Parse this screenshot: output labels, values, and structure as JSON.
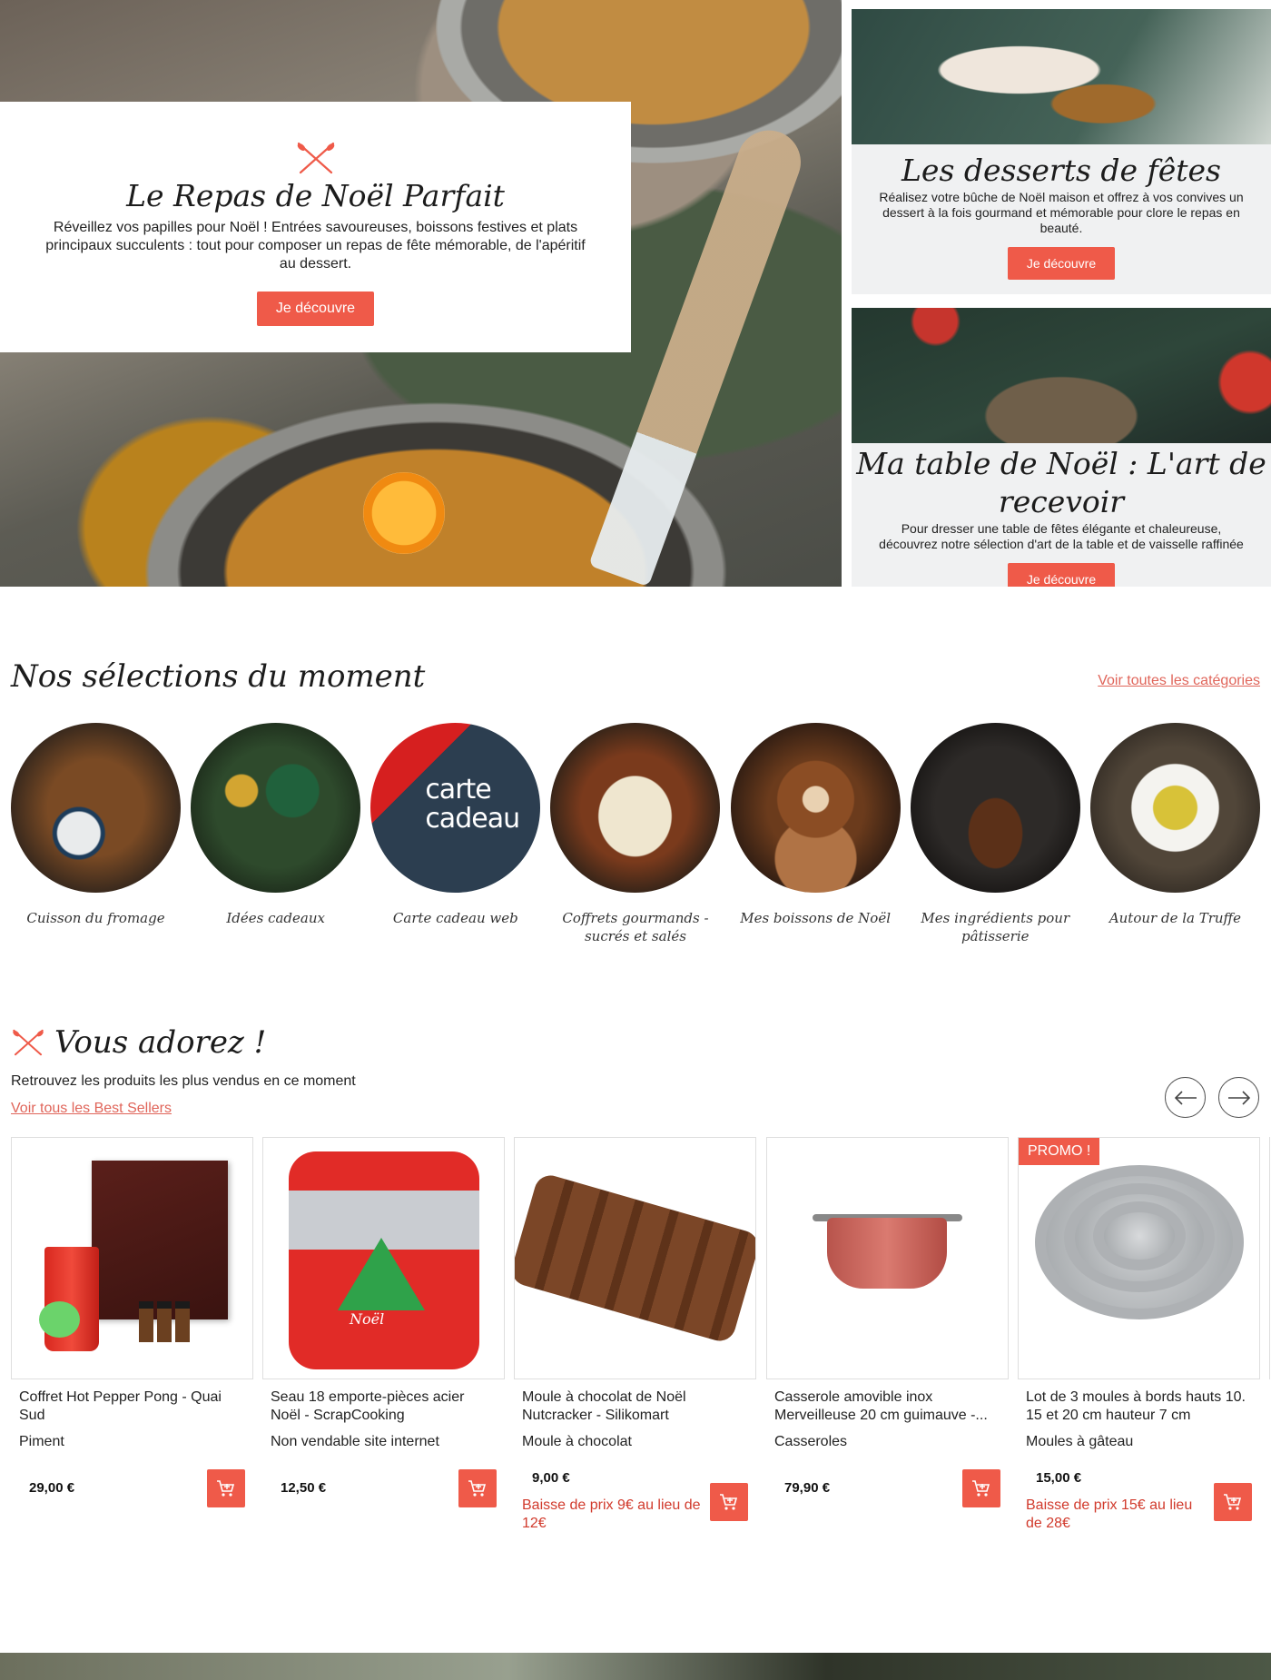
{
  "hero": {
    "title": "Le Repas de Noël Parfait",
    "text": "Réveillez vos papilles pour Noël ! Entrées savoureuses, boissons festives et plats principaux succulents : tout pour composer un repas de fête mémorable, de l'apéritif au dessert.",
    "button": "Je découvre"
  },
  "side_cards": [
    {
      "title": "Les desserts de fêtes",
      "text": "Réalisez votre bûche de Noël maison et offrez à vos convives un dessert à la fois gourmand et mémorable pour clore le repas en beauté.",
      "button": "Je découvre"
    },
    {
      "title": "Ma table de Noël : L'art de recevoir",
      "text": "Pour dresser une table de fêtes élégante et chaleureuse, découvrez notre sélection d'art de la table et de vaisselle raffinée",
      "button": "Je découvre"
    }
  ],
  "selections": {
    "title": "Nos sélections du moment",
    "link": "Voir toutes les catégories",
    "categories": [
      {
        "label": "Cuisson du fromage"
      },
      {
        "label": "Idées cadeaux"
      },
      {
        "label": "Carte cadeau web",
        "image_text": "carte cadeau"
      },
      {
        "label": "Coffrets gourmands - sucrés et salés"
      },
      {
        "label": "Mes boissons de Noël"
      },
      {
        "label": "Mes ingrédients pour pâtisserie"
      },
      {
        "label": "Autour de la Truffe"
      }
    ]
  },
  "bestsellers": {
    "title": "Vous adorez !",
    "subtitle": "Retrouvez les produits les plus vendus en ce moment",
    "link": "Voir tous les Best Sellers",
    "products": [
      {
        "name": "Coffret Hot Pepper Pong - Quai Sud",
        "category": "Piment",
        "price": "29,00 €"
      },
      {
        "name": "Seau 18 emporte-pièces acier Noël - ScrapCooking",
        "category": "Non vendable site internet",
        "price": "12,50 €",
        "image_text": "Noël"
      },
      {
        "name": "Moule à chocolat de Noël Nutcracker - Silikomart",
        "category": "Moule à chocolat",
        "price": "9,00 €",
        "promo": "Baisse de prix 9€ au lieu de 12€"
      },
      {
        "name": "Casserole amovible inox Merveilleuse 20 cm guimauve -...",
        "category": "Casseroles",
        "price": "79,90 €"
      },
      {
        "name": "Lot de 3 moules à bords hauts 10. 15 et 20 cm hauteur 7 cm",
        "category": "Moules à gâteau",
        "price": "15,00 €",
        "promo": "Baisse de prix 15€ au lieu de 28€",
        "badge": "PROMO !"
      }
    ]
  },
  "colors": {
    "accent": "#ef5a49",
    "link": "#e0655a",
    "promo_text": "#d13a2c"
  }
}
